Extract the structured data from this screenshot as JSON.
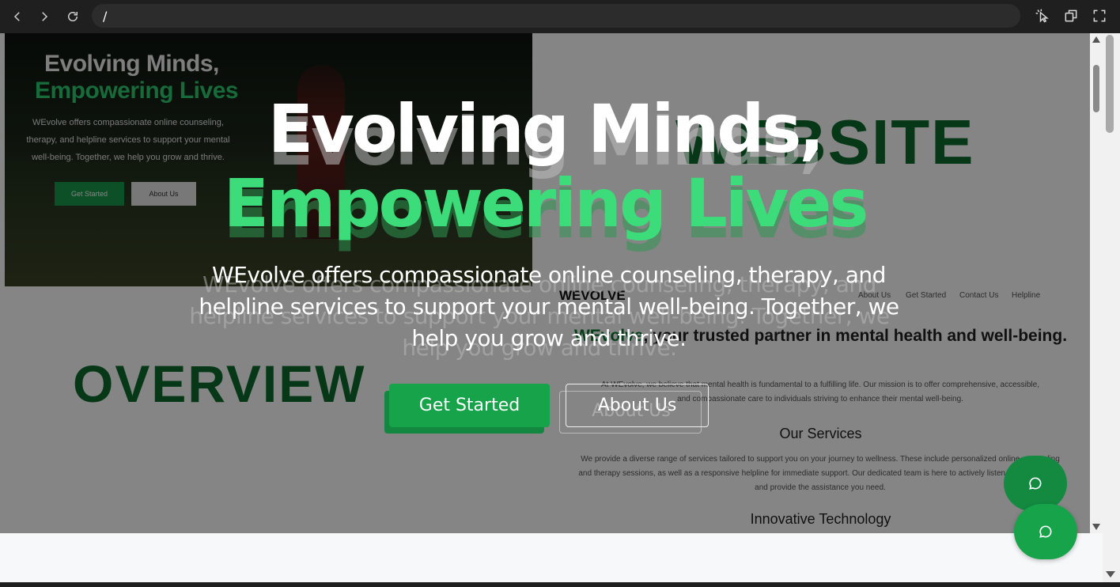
{
  "browser": {
    "url": "/",
    "icons": [
      "back-icon",
      "forward-icon",
      "reload-icon",
      "cursor-icon",
      "copy-window-icon",
      "fullscreen-icon"
    ]
  },
  "background": {
    "preview_title_line1": "Evolving Minds,",
    "preview_title_line2": "Empowering Lives",
    "preview_desc": "WEvolve offers compassionate online counseling, therapy, and helpline services to support your mental well-being. Together, we help you grow and thrive.",
    "preview_btn_start": "Get Started",
    "preview_btn_about": "About Us",
    "website_word": "WEBSITE",
    "overview_word": "OVERVIEW",
    "doc_logo": "WEVOLVE",
    "doc_nav": [
      "About Us",
      "Get Started",
      "Contact Us",
      "Helpline"
    ],
    "doc_heading_pre": "",
    "doc_heading_brand": "WEvolve",
    "doc_heading_rest": ", your trusted partner in mental health and well-being.",
    "doc_p1": "At WEvolve, we believe that mental health is fundamental to a fulfilling life. Our mission is to offer comprehensive, accessible, and compassionate care to individuals striving to enhance their mental well-being.",
    "doc_services_heading": "Our Services",
    "doc_services_text": "We provide a diverse range of services tailored to support you on your journey to wellness. These include personalized online counseling and therapy sessions, as well as a responsive helpline for immediate support. Our dedicated team is here to actively listen, offer guidance, and provide the assistance you need.",
    "doc_tech_heading": "Innovative Technology"
  },
  "hero": {
    "title": "Evolving Minds,",
    "subtitle": "Empowering Lives",
    "description": "WEvolve offers compassionate online counseling, therapy, and helpline services to support your mental well-being. Together, we help you grow and thrive.",
    "primary_button": "Get Started",
    "secondary_button": "About Us"
  },
  "colors": {
    "brand_green": "#16a34a",
    "accent_green": "#3ddc7a",
    "dark_green": "#0d6b2e"
  }
}
